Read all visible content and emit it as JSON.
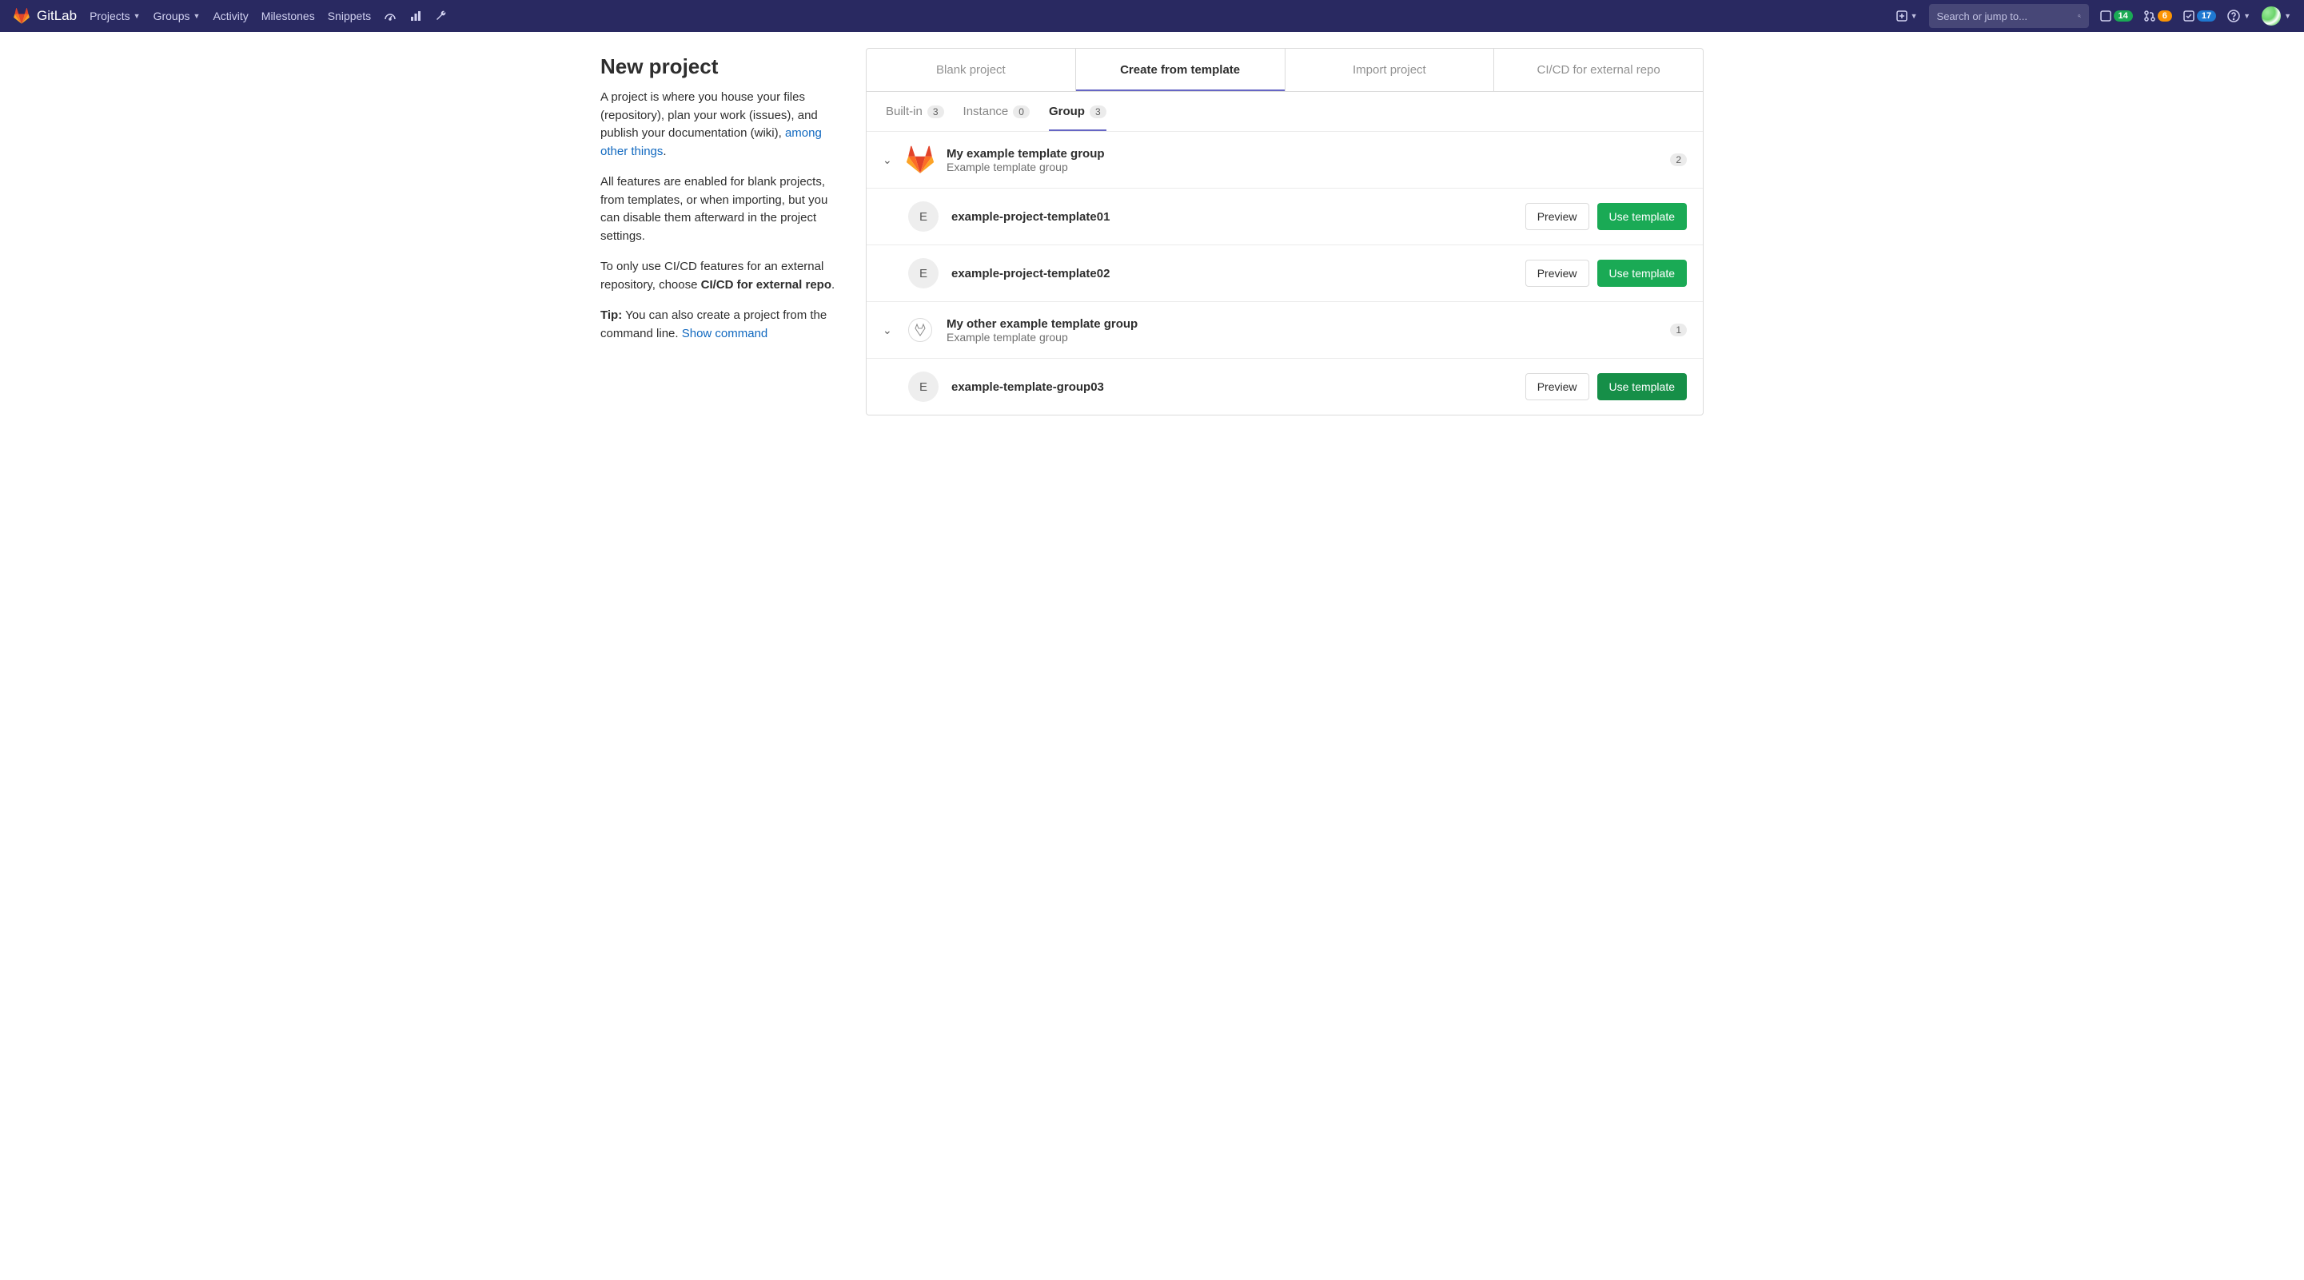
{
  "nav": {
    "brand": "GitLab",
    "projects": "Projects",
    "groups": "Groups",
    "activity": "Activity",
    "milestones": "Milestones",
    "snippets": "Snippets",
    "search_placeholder": "Search or jump to...",
    "issues_count": "14",
    "mr_count": "6",
    "todo_count": "17"
  },
  "sidebar": {
    "title": "New project",
    "p1a": "A project is where you house your files (repository), plan your work (issues), and publish your documentation (wiki), ",
    "p1_link": "among other things",
    "p1b": ".",
    "p2": "All features are enabled for blank projects, from templates, or when importing, but you can disable them afterward in the project settings.",
    "p3a": "To only use CI/CD features for an external repository, choose ",
    "p3b": "CI/CD for external repo",
    "p3c": ".",
    "p4a": "Tip:",
    "p4b": " You can also create a project from the command line. ",
    "p4_link": "Show command"
  },
  "tabs": {
    "blank": "Blank project",
    "template": "Create from template",
    "import": "Import project",
    "cicd": "CI/CD for external repo"
  },
  "sub_tabs": {
    "builtin": "Built-in",
    "builtin_count": "3",
    "instance": "Instance",
    "instance_count": "0",
    "group": "Group",
    "group_count": "3"
  },
  "groups": [
    {
      "name": "My example template group",
      "desc": "Example template group",
      "count": "2",
      "logo": "gitlab",
      "templates": [
        {
          "initial": "E",
          "name": "example-project-template01"
        },
        {
          "initial": "E",
          "name": "example-project-template02"
        }
      ]
    },
    {
      "name": "My other example template group",
      "desc": "Example template group",
      "count": "1",
      "logo": "other",
      "templates": [
        {
          "initial": "E",
          "name": "example-template-group03",
          "dark": true
        }
      ]
    }
  ],
  "buttons": {
    "preview": "Preview",
    "use": "Use template"
  }
}
